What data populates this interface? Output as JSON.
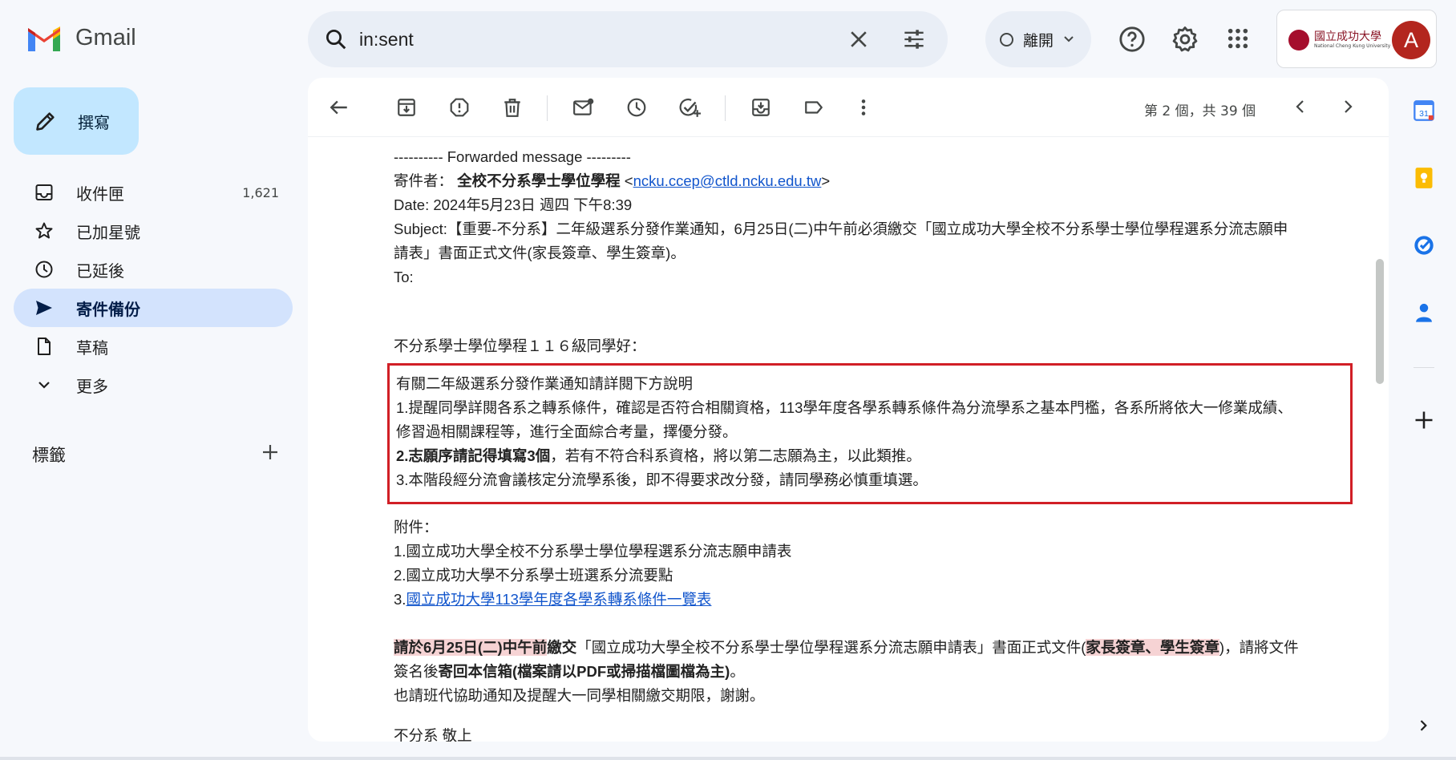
{
  "app": {
    "name": "Gmail"
  },
  "search": {
    "query": "in:sent"
  },
  "status": {
    "label": "離開"
  },
  "account": {
    "university_zh": "國立成功大學",
    "university_en": "National Cheng Kung University",
    "avatar_letter": "A"
  },
  "compose": {
    "label": "撰寫"
  },
  "nav": {
    "inbox": {
      "label": "收件匣",
      "count": "1,621"
    },
    "starred": {
      "label": "已加星號"
    },
    "snoozed": {
      "label": "已延後"
    },
    "sent": {
      "label": "寄件備份"
    },
    "drafts": {
      "label": "草稿"
    },
    "more": {
      "label": "更多"
    }
  },
  "labels": {
    "heading": "標籤"
  },
  "toolbar": {
    "pager": "第 2 個，共 39 個"
  },
  "email": {
    "forward_line": "---------- Forwarded message ---------",
    "from_label": "寄件者：",
    "from_name": "全校不分系學士學位學程",
    "from_email": "ncku.ccep@ctld.ncku.edu.tw",
    "date": "Date: 2024年5月23日 週四 下午8:39",
    "subject_1": "Subject:【重要-不分系】二年級選系分發作業通知，6月25日(二)中午前必須繳交「國立成功大學全校不分系學士學位學程選系分流志願申",
    "subject_2": "請表」書面正式文件(家長簽章、學生簽章)。",
    "to": "To:",
    "greeting": "不分系學士學位學程１１６級同學好：",
    "box_intro": "有關二年級選系分發作業通知請詳閱下方說明",
    "box_1a": "1.提醒同學詳閱各系之轉系條件，確認是否符合相關資格，113學年度各學系轉系條件為分流學系之基本門檻，各系所將依大一修業成績、",
    "box_1b": "修習過相關課程等，進行全面綜合考量，擇優分發。",
    "box_2_bold": "2.志願序請記得填寫3個",
    "box_2_rest": "，若有不符合科系資格，將以第二志願為主，以此類推。",
    "box_3": "3.本階段經分流會議核定分流學系後，即不得要求改分發，請同學務必慎重填選。",
    "attach_heading": "附件：",
    "attach_1": "1.國立成功大學全校不分系學士學位學程選系分流志願申請表",
    "attach_2": "2.國立成功大學不分系學士班選系分流要點",
    "attach_3_num": "3.",
    "attach_3_link": "國立成功大學113學年度各學系轉系條件一覽表",
    "deadline_hl": "請於6月25日(二)中午前",
    "deadline_b": "繳交",
    "deadline_mid": "「國立成功大學全校不分系學士學位學程選系分流志願申請表」書面正式文件(",
    "deadline_hl2": "家長簽章、學生簽章",
    "deadline_end": ")，請將文件",
    "sign_pre": "簽名後",
    "sign_bold": "寄回本信箱(檔案請以PDF或掃描檔圖檔為主)",
    "sign_end": "。",
    "remind": "也請班代協助通知及提醒大一同學相關繳交期限，謝謝。",
    "cut_sig": "不分系 敬上"
  },
  "rail": {
    "calendar_day": "31"
  },
  "colors": {
    "compose_bg": "#c2e7ff",
    "active_nav": "#d3e3fd",
    "highlight_box": "#d11f26",
    "link": "#1155cc",
    "text_highlight": "#f6d3d4"
  }
}
